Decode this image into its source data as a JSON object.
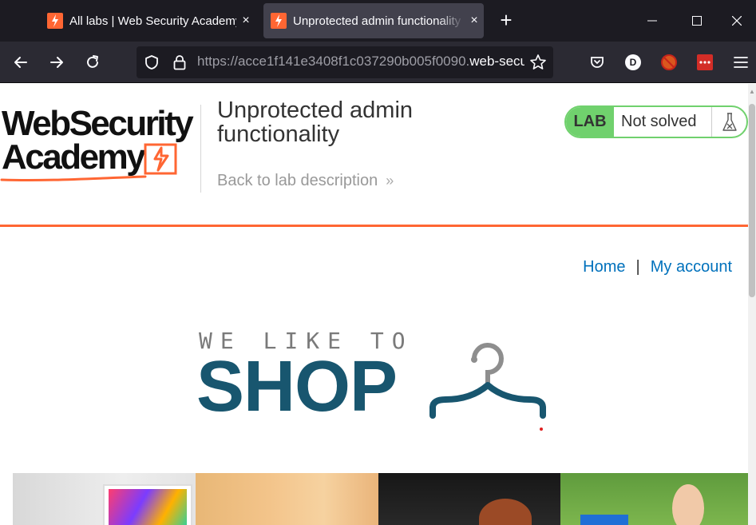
{
  "browser": {
    "tabs": [
      {
        "title": "All labs | Web Security Academy",
        "active": false
      },
      {
        "title": "Unprotected admin functionality",
        "active": true
      }
    ],
    "new_tab_label": "+",
    "url": {
      "scheme": "https://",
      "host_prefix": "acce1f141e3408f1c037290b005f0090.",
      "host_rest": "web-security-academy.net"
    },
    "extension_badge": "D",
    "tab_close_glyph": "×"
  },
  "header": {
    "logo_line1": "WebSecurity",
    "logo_line2": "Academy",
    "lab_title": "Unprotected admin functionality",
    "back_link": "Back to lab description",
    "back_chevrons": "»",
    "lab_badge": "LAB",
    "lab_status": "Not solved"
  },
  "nav": {
    "home": "Home",
    "separator": "|",
    "my_account": "My account"
  },
  "banner": {
    "tagline": "WE LIKE TO",
    "headline": "SHOP"
  },
  "colors": {
    "accent_orange": "#ff6633",
    "lab_green": "#70d16d",
    "link_blue": "#0071bc",
    "shop_blue": "#18566f"
  }
}
